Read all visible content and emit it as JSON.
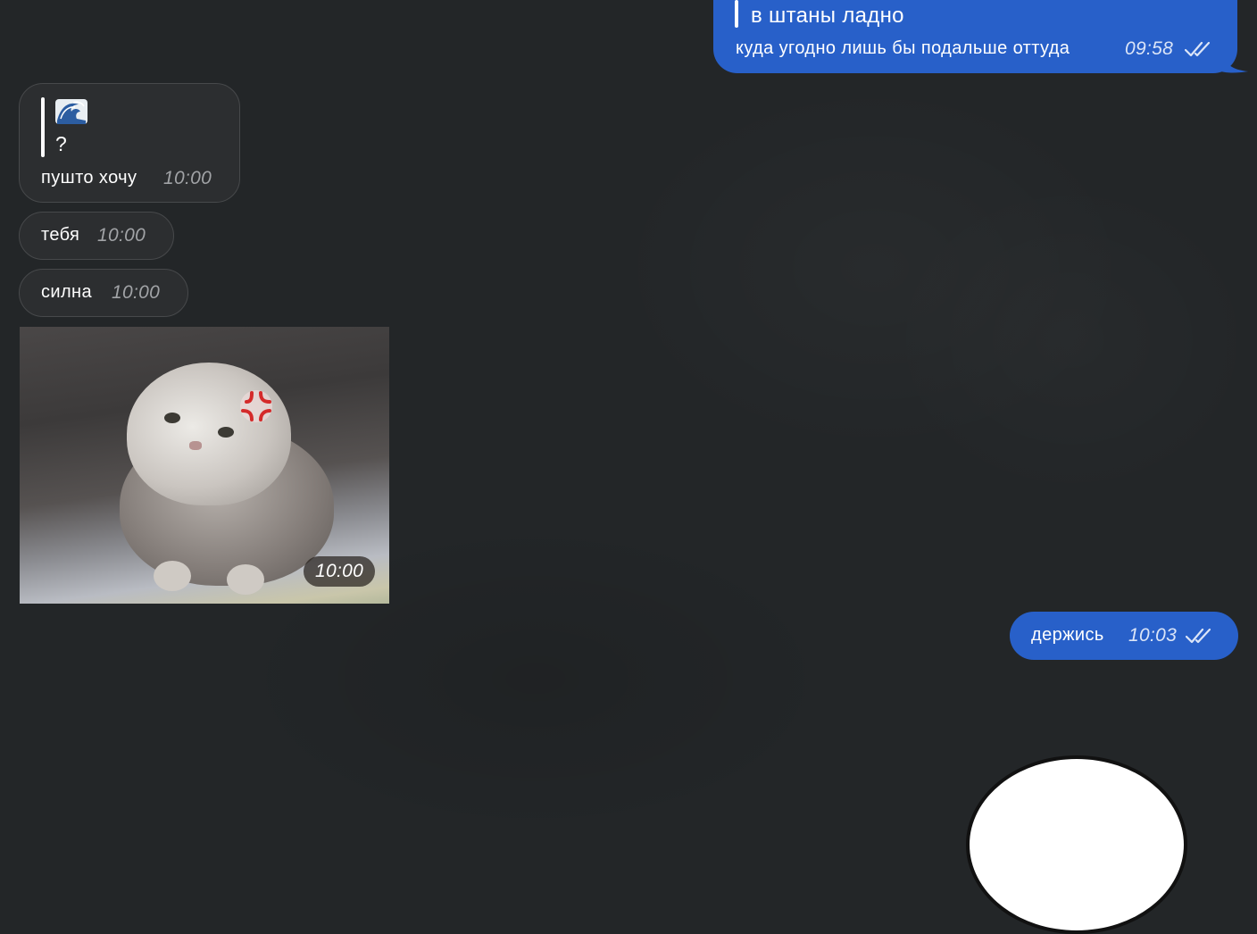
{
  "colors": {
    "background": "#232628",
    "incoming_bubble": "#2c2e30",
    "outgoing_bubble": "#2860c9"
  },
  "messages": {
    "top_outgoing": {
      "quote": "в штаны ладно",
      "text": "куда угодно лишь бы подальше оттуда",
      "time": "09:58",
      "status_icon": "double-check-icon"
    },
    "reply": {
      "quote_emoji": "wave-emoji",
      "quote_text": "?",
      "text": "пушто хочу",
      "time": "10:00"
    },
    "tebya": {
      "text": "тебя",
      "time": "10:00"
    },
    "silna": {
      "text": "силна",
      "time": "10:00"
    },
    "photo": {
      "content": "angry-kitten-photo",
      "time": "10:00"
    },
    "hold_on": {
      "text": "держись",
      "time": "10:03",
      "status_icon": "double-check-icon"
    }
  }
}
